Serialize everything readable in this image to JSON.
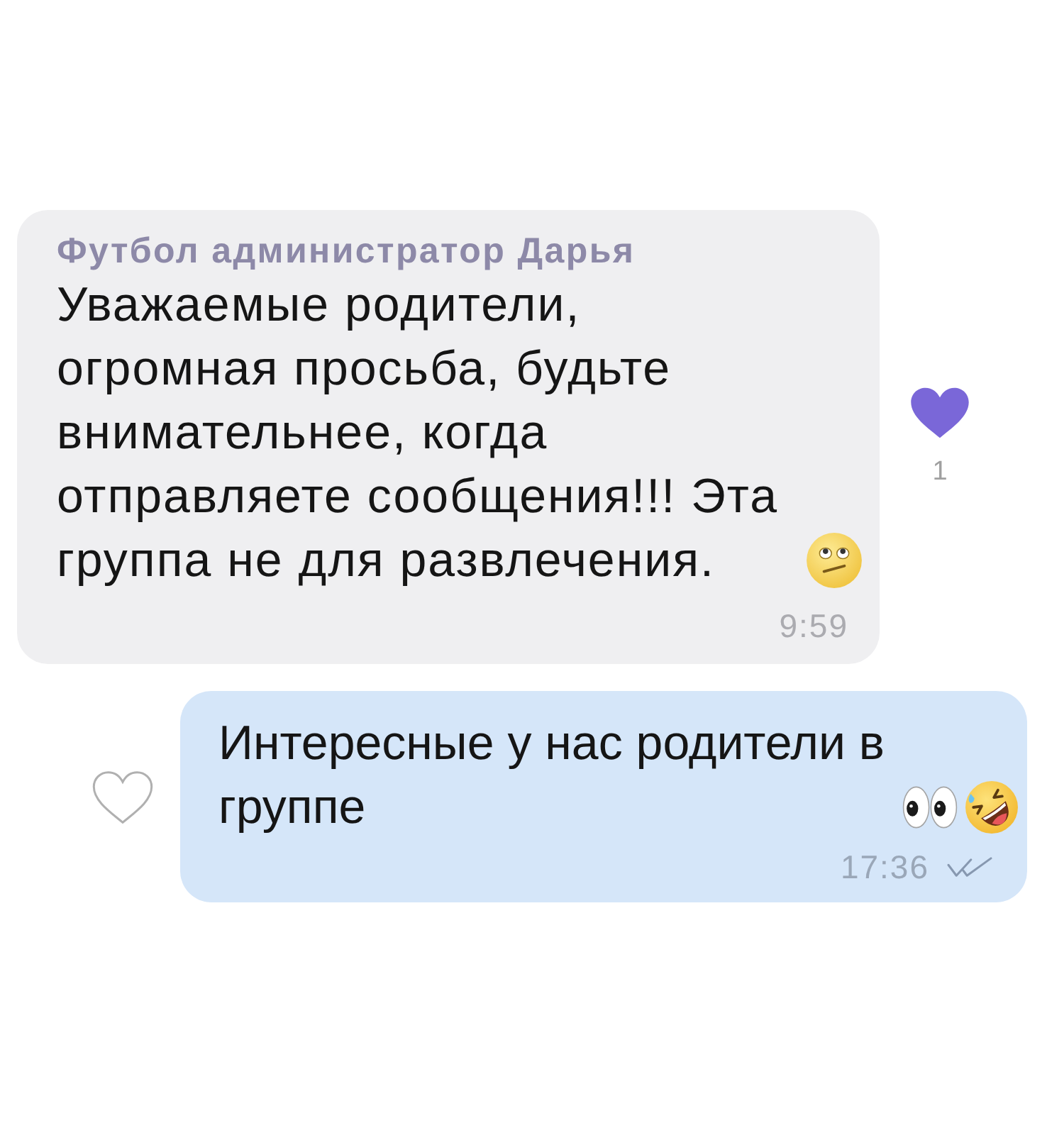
{
  "messages": [
    {
      "kind": "incoming",
      "sender": "Футбол администратор Дарья",
      "text": "Уважаемые родители, огромная просьба, будьте внимательнее, когда отправляете сообщения!!! Эта группа не для развлечения.",
      "time": "9:59",
      "liked": true,
      "like_count": "1"
    },
    {
      "kind": "outgoing",
      "text": "Интересные у нас родители в группе",
      "time": "17:36",
      "liked": false,
      "read": true
    }
  ]
}
